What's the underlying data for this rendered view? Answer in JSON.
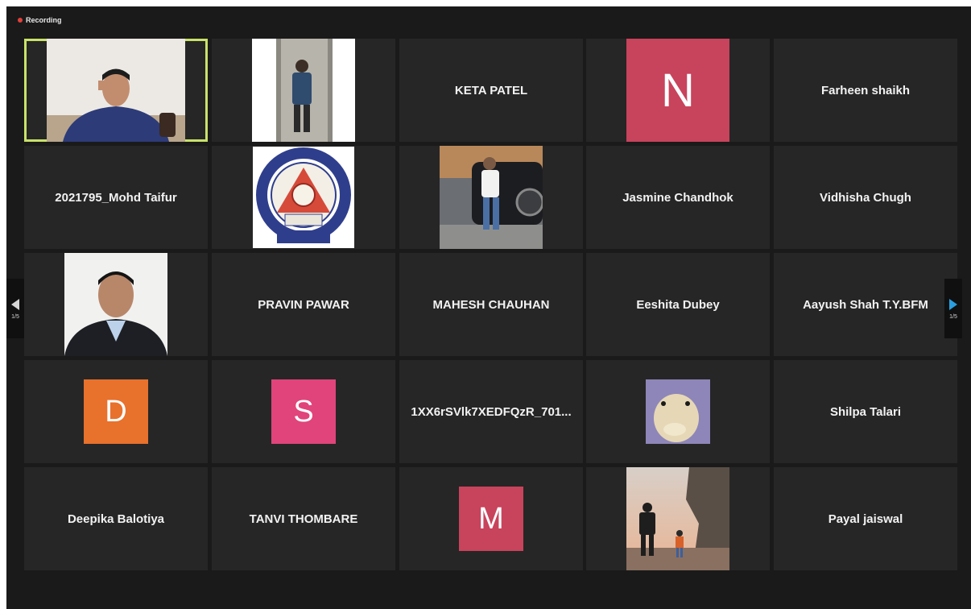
{
  "recording": {
    "label": "Recording"
  },
  "navigation": {
    "prev_page": "1/5",
    "next_page": "1/5"
  },
  "participants": [
    {
      "type": "video",
      "icon": "man-at-desk-video"
    },
    {
      "type": "photo",
      "icon": "person-photo"
    },
    {
      "type": "name",
      "name": "KETA PATEL"
    },
    {
      "type": "letter",
      "letter": "N",
      "color": "#c8435c"
    },
    {
      "type": "name",
      "name": "Farheen shaikh"
    },
    {
      "type": "name",
      "name": "2021795_Mohd Taifur"
    },
    {
      "type": "photo",
      "icon": "college-logo"
    },
    {
      "type": "photo",
      "icon": "man-with-car-photo"
    },
    {
      "type": "name",
      "name": "Jasmine Chandhok"
    },
    {
      "type": "name",
      "name": "Vidhisha Chugh"
    },
    {
      "type": "photo",
      "icon": "man-in-suit-photo"
    },
    {
      "type": "name",
      "name": "PRAVIN PAWAR"
    },
    {
      "type": "name",
      "name": "MAHESH CHAUHAN"
    },
    {
      "type": "name",
      "name": "Eeshita Dubey"
    },
    {
      "type": "name",
      "name": "Aayush Shah T.Y.BFM"
    },
    {
      "type": "letter",
      "letter": "D",
      "color": "#e8712c"
    },
    {
      "type": "letter",
      "letter": "S",
      "color": "#e0447a"
    },
    {
      "type": "name",
      "name": "1XX6rSVlk7XEDFQzR_701..."
    },
    {
      "type": "photo",
      "icon": "duck-photo"
    },
    {
      "type": "name",
      "name": "Shilpa Talari"
    },
    {
      "type": "name",
      "name": "Deepika Balotiya"
    },
    {
      "type": "name",
      "name": "TANVI THOMBARE"
    },
    {
      "type": "letter",
      "letter": "M",
      "color": "#c8435c"
    },
    {
      "type": "photo",
      "icon": "beach-father-child-photo"
    },
    {
      "type": "name",
      "name": "Payal jaiswal"
    }
  ],
  "colors": {
    "active_speaker_border": "#c9e26a",
    "tile_background": "#262626",
    "recording_dot": "#e0413a",
    "next_arrow": "#2a9ee0"
  }
}
